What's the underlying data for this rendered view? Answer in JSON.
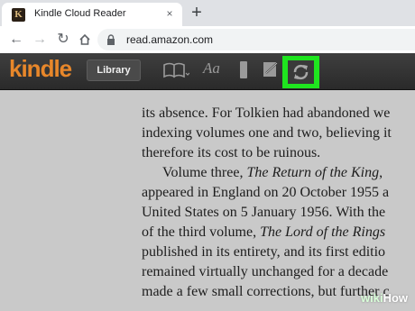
{
  "browser": {
    "tab": {
      "title": "Kindle Cloud Reader",
      "favicon_letter": "K",
      "close_icon": "×"
    },
    "new_tab_icon": "+",
    "nav": {
      "back_icon": "←",
      "forward_icon": "→",
      "reload_icon": "↻"
    },
    "url": "read.amazon.com"
  },
  "kindle": {
    "logo": "kindle",
    "library_label": "Library",
    "toolbar_icons": [
      "book-icon",
      "font-icon",
      "bookmark-icon",
      "notes-icon",
      "sync-icon"
    ],
    "font_glyph": "Aa",
    "highlight_color": "#1fe51f",
    "logo_color": "#e8872a"
  },
  "reader": {
    "lines": [
      "its absence. For Tolkien had abandoned we",
      "indexing volumes one and two, believing it",
      "therefore its cost to be ruinous.",
      "Volume three, The Return of the King, ",
      "appeared in England on 20 October 1955 a",
      "United States on 5 January 1956. With the",
      "of the third volume, The Lord of the Rings",
      "published in its entirety, and its first editio",
      "remained virtually unchanged for a decade",
      "made a few small corrections, but further c"
    ]
  },
  "watermark": {
    "prefix": "wiki",
    "suffix": "How"
  }
}
